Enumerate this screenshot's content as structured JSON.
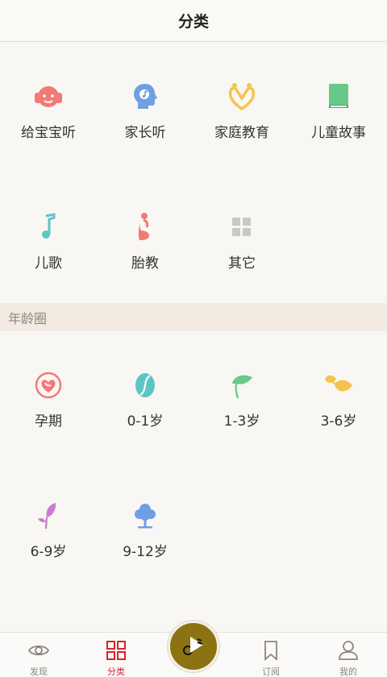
{
  "header": {
    "title": "分类"
  },
  "categories": [
    {
      "label": "给宝宝听",
      "icon": "baby-headphones-icon",
      "color": "#f07a76"
    },
    {
      "label": "家长听",
      "icon": "head-music-icon",
      "color": "#6f9fe3"
    },
    {
      "label": "家庭教育",
      "icon": "family-heart-icon",
      "color": "#f4c44d"
    },
    {
      "label": "儿童故事",
      "icon": "book-icon",
      "color": "#66c98a"
    },
    {
      "label": "儿歌",
      "icon": "music-note-icon",
      "color": "#5cc6c4"
    },
    {
      "label": "胎教",
      "icon": "pregnant-icon",
      "color": "#f07a76"
    },
    {
      "label": "其它",
      "icon": "grid-icon",
      "color": "#c8c8c8"
    }
  ],
  "age_section": {
    "title": "年龄圈"
  },
  "ages": [
    {
      "label": "孕期",
      "icon": "pregnancy-heart-icon",
      "color": "#f07a76"
    },
    {
      "label": "0-1岁",
      "icon": "seed-icon",
      "color": "#5cc6c4"
    },
    {
      "label": "1-3岁",
      "icon": "sprout-icon",
      "color": "#66c98a"
    },
    {
      "label": "3-6岁",
      "icon": "leaves-icon",
      "color": "#f4c44d"
    },
    {
      "label": "6-9岁",
      "icon": "plant-icon",
      "color": "#c97ccf"
    },
    {
      "label": "9-12岁",
      "icon": "tree-icon",
      "color": "#6f9fe3"
    }
  ],
  "tabbar": {
    "tabs": [
      {
        "label": "发现",
        "icon": "eye-icon"
      },
      {
        "label": "分类",
        "icon": "category-grid-icon",
        "active": true
      },
      {
        "label": "订阅",
        "icon": "bookmark-icon"
      },
      {
        "label": "我的",
        "icon": "user-icon"
      }
    ],
    "play_icon": "play-icon",
    "active_color": "#d0252b"
  }
}
